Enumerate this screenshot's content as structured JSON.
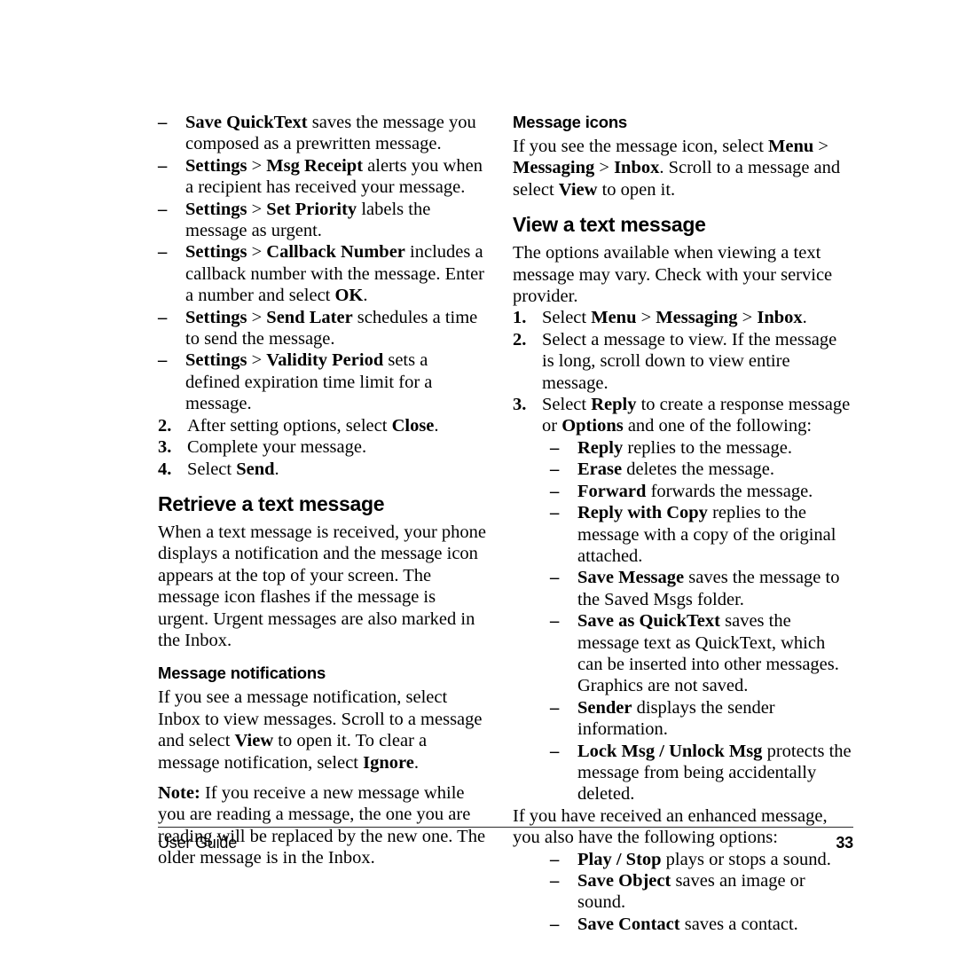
{
  "document": {
    "type": "user-guide-page",
    "page_number": "33",
    "footer_label": "User Guide"
  },
  "left_column": {
    "continued_dash_list": [
      {
        "segments": [
          {
            "text": "Save QuickText",
            "bold": true
          },
          {
            "text": " saves the message you composed as a prewritten message.",
            "bold": false
          }
        ]
      },
      {
        "segments": [
          {
            "text": "Settings",
            "bold": true
          },
          {
            "text": " > ",
            "bold": false
          },
          {
            "text": "Msg Receipt",
            "bold": true
          },
          {
            "text": " alerts you when a recipient has received your message.",
            "bold": false
          }
        ]
      },
      {
        "segments": [
          {
            "text": "Settings",
            "bold": true
          },
          {
            "text": " > ",
            "bold": false
          },
          {
            "text": "Set Priority",
            "bold": true
          },
          {
            "text": " labels the message as urgent.",
            "bold": false
          }
        ]
      },
      {
        "segments": [
          {
            "text": "Settings",
            "bold": true
          },
          {
            "text": " > ",
            "bold": false
          },
          {
            "text": "Callback Number",
            "bold": true
          },
          {
            "text": " includes a callback number with the message. Enter a number and select ",
            "bold": false
          },
          {
            "text": "OK",
            "bold": true
          },
          {
            "text": ".",
            "bold": false
          }
        ]
      },
      {
        "segments": [
          {
            "text": "Settings",
            "bold": true
          },
          {
            "text": " > ",
            "bold": false
          },
          {
            "text": "Send Later",
            "bold": true
          },
          {
            "text": " schedules a time to send the message.",
            "bold": false
          }
        ]
      },
      {
        "segments": [
          {
            "text": "Settings",
            "bold": true
          },
          {
            "text": " > ",
            "bold": false
          },
          {
            "text": "Validity Period",
            "bold": true
          },
          {
            "text": " sets a defined expiration time limit for a message.",
            "bold": false
          }
        ]
      }
    ],
    "continued_steps": [
      {
        "number": "2.",
        "segments": [
          {
            "text": "After setting options, select ",
            "bold": false
          },
          {
            "text": "Close",
            "bold": true
          },
          {
            "text": ".",
            "bold": false
          }
        ]
      },
      {
        "number": "3.",
        "segments": [
          {
            "text": "Complete your message.",
            "bold": false
          }
        ]
      },
      {
        "number": "4.",
        "segments": [
          {
            "text": "Select ",
            "bold": false
          },
          {
            "text": "Send",
            "bold": true
          },
          {
            "text": ".",
            "bold": false
          }
        ]
      }
    ],
    "section_heading": "Retrieve a text message",
    "section_paragraph": [
      {
        "text": "When a text message is received, your phone displays a notification and the message icon appears at the top of your screen. The message icon flashes if the message is urgent. Urgent messages are also marked in the Inbox.",
        "bold": false
      }
    ],
    "sub_heading": "Message notifications",
    "sub_paragraph_1": [
      {
        "text": "If you see a message notification, select Inbox to view messages. Scroll to a message and select ",
        "bold": false
      },
      {
        "text": "View",
        "bold": true
      },
      {
        "text": " to open it. To clear a message notification, select ",
        "bold": false
      },
      {
        "text": "Ignore",
        "bold": true
      },
      {
        "text": ".",
        "bold": false
      }
    ],
    "sub_paragraph_2": [
      {
        "text": "Note:",
        "bold": true
      },
      {
        "text": " If you receive a new message while you are reading a message, the one you are reading will be replaced by the new one. The older message is in the Inbox.",
        "bold": false
      }
    ]
  },
  "right_column": {
    "sub_heading": "Message icons",
    "sub_paragraph": [
      {
        "text": "If you see the message icon, select ",
        "bold": false
      },
      {
        "text": "Menu",
        "bold": true
      },
      {
        "text": " > ",
        "bold": false
      },
      {
        "text": "Messaging",
        "bold": true
      },
      {
        "text": " > ",
        "bold": false
      },
      {
        "text": "Inbox",
        "bold": true
      },
      {
        "text": ". Scroll to a message and select ",
        "bold": false
      },
      {
        "text": "View",
        "bold": true
      },
      {
        "text": " to open it.",
        "bold": false
      }
    ],
    "section_heading": "View a text message",
    "section_paragraph": [
      {
        "text": "The options available when viewing a text message may vary. Check with your service provider.",
        "bold": false
      }
    ],
    "steps": [
      {
        "number": "1.",
        "segments": [
          {
            "text": "Select ",
            "bold": false
          },
          {
            "text": "Menu",
            "bold": true
          },
          {
            "text": " > ",
            "bold": false
          },
          {
            "text": "Messaging",
            "bold": true
          },
          {
            "text": " > ",
            "bold": false
          },
          {
            "text": "Inbox",
            "bold": true
          },
          {
            "text": ".",
            "bold": false
          }
        ]
      },
      {
        "number": "2.",
        "segments": [
          {
            "text": "Select a message to view. If the message is long, scroll down to view entire message.",
            "bold": false
          }
        ]
      },
      {
        "number": "3.",
        "segments": [
          {
            "text": "Select ",
            "bold": false
          },
          {
            "text": "Reply",
            "bold": true
          },
          {
            "text": " to create a response message or ",
            "bold": false
          },
          {
            "text": "Options",
            "bold": true
          },
          {
            "text": " and one of the following:",
            "bold": false
          }
        ]
      }
    ],
    "option_dash_list": [
      {
        "segments": [
          {
            "text": "Reply",
            "bold": true
          },
          {
            "text": " replies to the message.",
            "bold": false
          }
        ]
      },
      {
        "segments": [
          {
            "text": "Erase",
            "bold": true
          },
          {
            "text": " deletes the message.",
            "bold": false
          }
        ]
      },
      {
        "segments": [
          {
            "text": "Forward",
            "bold": true
          },
          {
            "text": " forwards the message.",
            "bold": false
          }
        ]
      },
      {
        "segments": [
          {
            "text": "Reply with Copy",
            "bold": true
          },
          {
            "text": " replies to the message with a copy of the original attached.",
            "bold": false
          }
        ]
      },
      {
        "segments": [
          {
            "text": "Save Message",
            "bold": true
          },
          {
            "text": " saves the message to the Saved Msgs folder.",
            "bold": false
          }
        ]
      },
      {
        "segments": [
          {
            "text": "Save as QuickText",
            "bold": true
          },
          {
            "text": " saves the message text as QuickText, which can be inserted into other messages. Graphics are not saved.",
            "bold": false
          }
        ]
      },
      {
        "segments": [
          {
            "text": "Sender",
            "bold": true
          },
          {
            "text": " displays the sender information.",
            "bold": false
          }
        ]
      },
      {
        "segments": [
          {
            "text": "Lock Msg / Unlock Msg",
            "bold": true
          },
          {
            "text": " protects the message from being accidentally deleted.",
            "bold": false
          }
        ]
      }
    ],
    "enhanced_paragraph": [
      {
        "text": "If you have received an enhanced message, you also have the following options:",
        "bold": false
      }
    ],
    "enhanced_dash_list": [
      {
        "segments": [
          {
            "text": "Play / Stop",
            "bold": true
          },
          {
            "text": " plays or stops a sound.",
            "bold": false
          }
        ]
      },
      {
        "segments": [
          {
            "text": "Save Object",
            "bold": true
          },
          {
            "text": " saves an image or sound.",
            "bold": false
          }
        ]
      },
      {
        "segments": [
          {
            "text": "Save Contact",
            "bold": true
          },
          {
            "text": " saves a contact.",
            "bold": false
          }
        ]
      }
    ]
  },
  "symbols": {
    "dash": "–"
  }
}
